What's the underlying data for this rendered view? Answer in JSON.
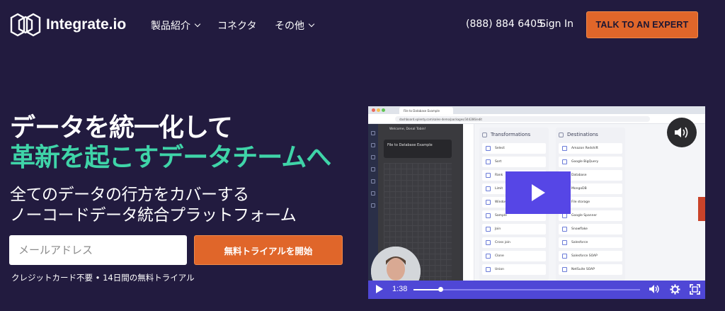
{
  "brand": {
    "name": "Integrate.io"
  },
  "nav": {
    "items": [
      {
        "label": "製品紹介",
        "dropdown": true
      },
      {
        "label": "コネクタ",
        "dropdown": false
      },
      {
        "label": "その他",
        "dropdown": true
      }
    ],
    "phone": "(888) 884 6405",
    "signin": "Sign In",
    "cta": "TALK TO AN EXPERT"
  },
  "hero": {
    "headline_line1": "データを統一化して",
    "headline_line2": "革新を起こすデータチームへ",
    "sub_line1": "全てのデータの行方をカバーする",
    "sub_line2": "ノーコードデータ統合プラットフォーム",
    "email_placeholder": "メールアドレス",
    "trial_button": "無料トライアルを開始",
    "note": "クレジットカード不要 • 14日間の無料トライアル"
  },
  "video": {
    "tab_title": "File to Database Example",
    "url": "dashboard.xplenty.com/sales-demo/packages/344286/edit",
    "welcome": "Welcome, Donal Tobin!",
    "package_title": "File to Database Example",
    "transformations_title": "Transformations",
    "transformations": [
      "Select",
      "Sort",
      "Rank",
      "Limit",
      "Window",
      "Sample",
      "Join",
      "Cross join",
      "Clone",
      "Union"
    ],
    "destinations_title": "Destinations",
    "destinations": [
      "Amazon Redshift",
      "Google BigQuery",
      "Database",
      "MongoDB",
      "File storage",
      "Google Spanner",
      "Snowflake",
      "Salesforce",
      "Salesforce SOAP",
      "NetSuite SOAP"
    ],
    "time": "1:38",
    "progress": 0.12,
    "colors": {
      "controls": "#4f47d6",
      "play": "#5646e6"
    }
  },
  "colors": {
    "background": "#221b3f",
    "accent_orange": "#e0662a",
    "accent_green": "#3fd4a8"
  }
}
